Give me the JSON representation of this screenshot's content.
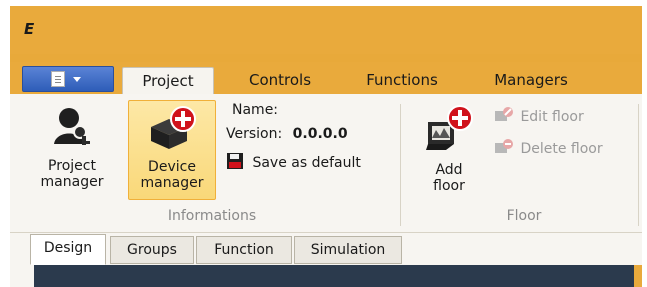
{
  "app": {
    "logo_text": "E"
  },
  "app_menu": {
    "icon": "document-icon"
  },
  "ribbon_tabs": [
    {
      "label": "Project",
      "active": true
    },
    {
      "label": "Controls",
      "active": false
    },
    {
      "label": "Functions",
      "active": false
    },
    {
      "label": "Managers",
      "active": false
    }
  ],
  "groups": {
    "informations": {
      "label": "Informations",
      "project_manager": {
        "line1": "Project",
        "line2": "manager",
        "icon": "user-key-icon"
      },
      "device_manager": {
        "line1": "Device",
        "line2": "manager",
        "icon": "device-add-icon"
      },
      "name_label": "Name:",
      "version_label": "Version:",
      "version_value": "0.0.0.0",
      "save_default": {
        "label": "Save as default",
        "icon": "save-icon"
      }
    },
    "floor": {
      "label": "Floor",
      "add_floor": {
        "line1": "Add",
        "line2": "floor",
        "icon": "add-floor-icon"
      },
      "edit_floor": {
        "label": "Edit floor",
        "icon": "edit-floor-icon",
        "enabled": false
      },
      "delete_floor": {
        "label": "Delete floor",
        "icon": "delete-floor-icon",
        "enabled": false
      }
    }
  },
  "doc_tabs": [
    {
      "label": "Design",
      "active": true
    },
    {
      "label": "Groups",
      "active": false
    },
    {
      "label": "Function",
      "active": false
    },
    {
      "label": "Simulation",
      "active": false
    }
  ],
  "colors": {
    "title_bar": "#e9aa3c",
    "app_menu": "#2e5db8",
    "highlight": "#f9d879",
    "plus_red": "#d0121b",
    "canvas": "#2b3a4d"
  }
}
